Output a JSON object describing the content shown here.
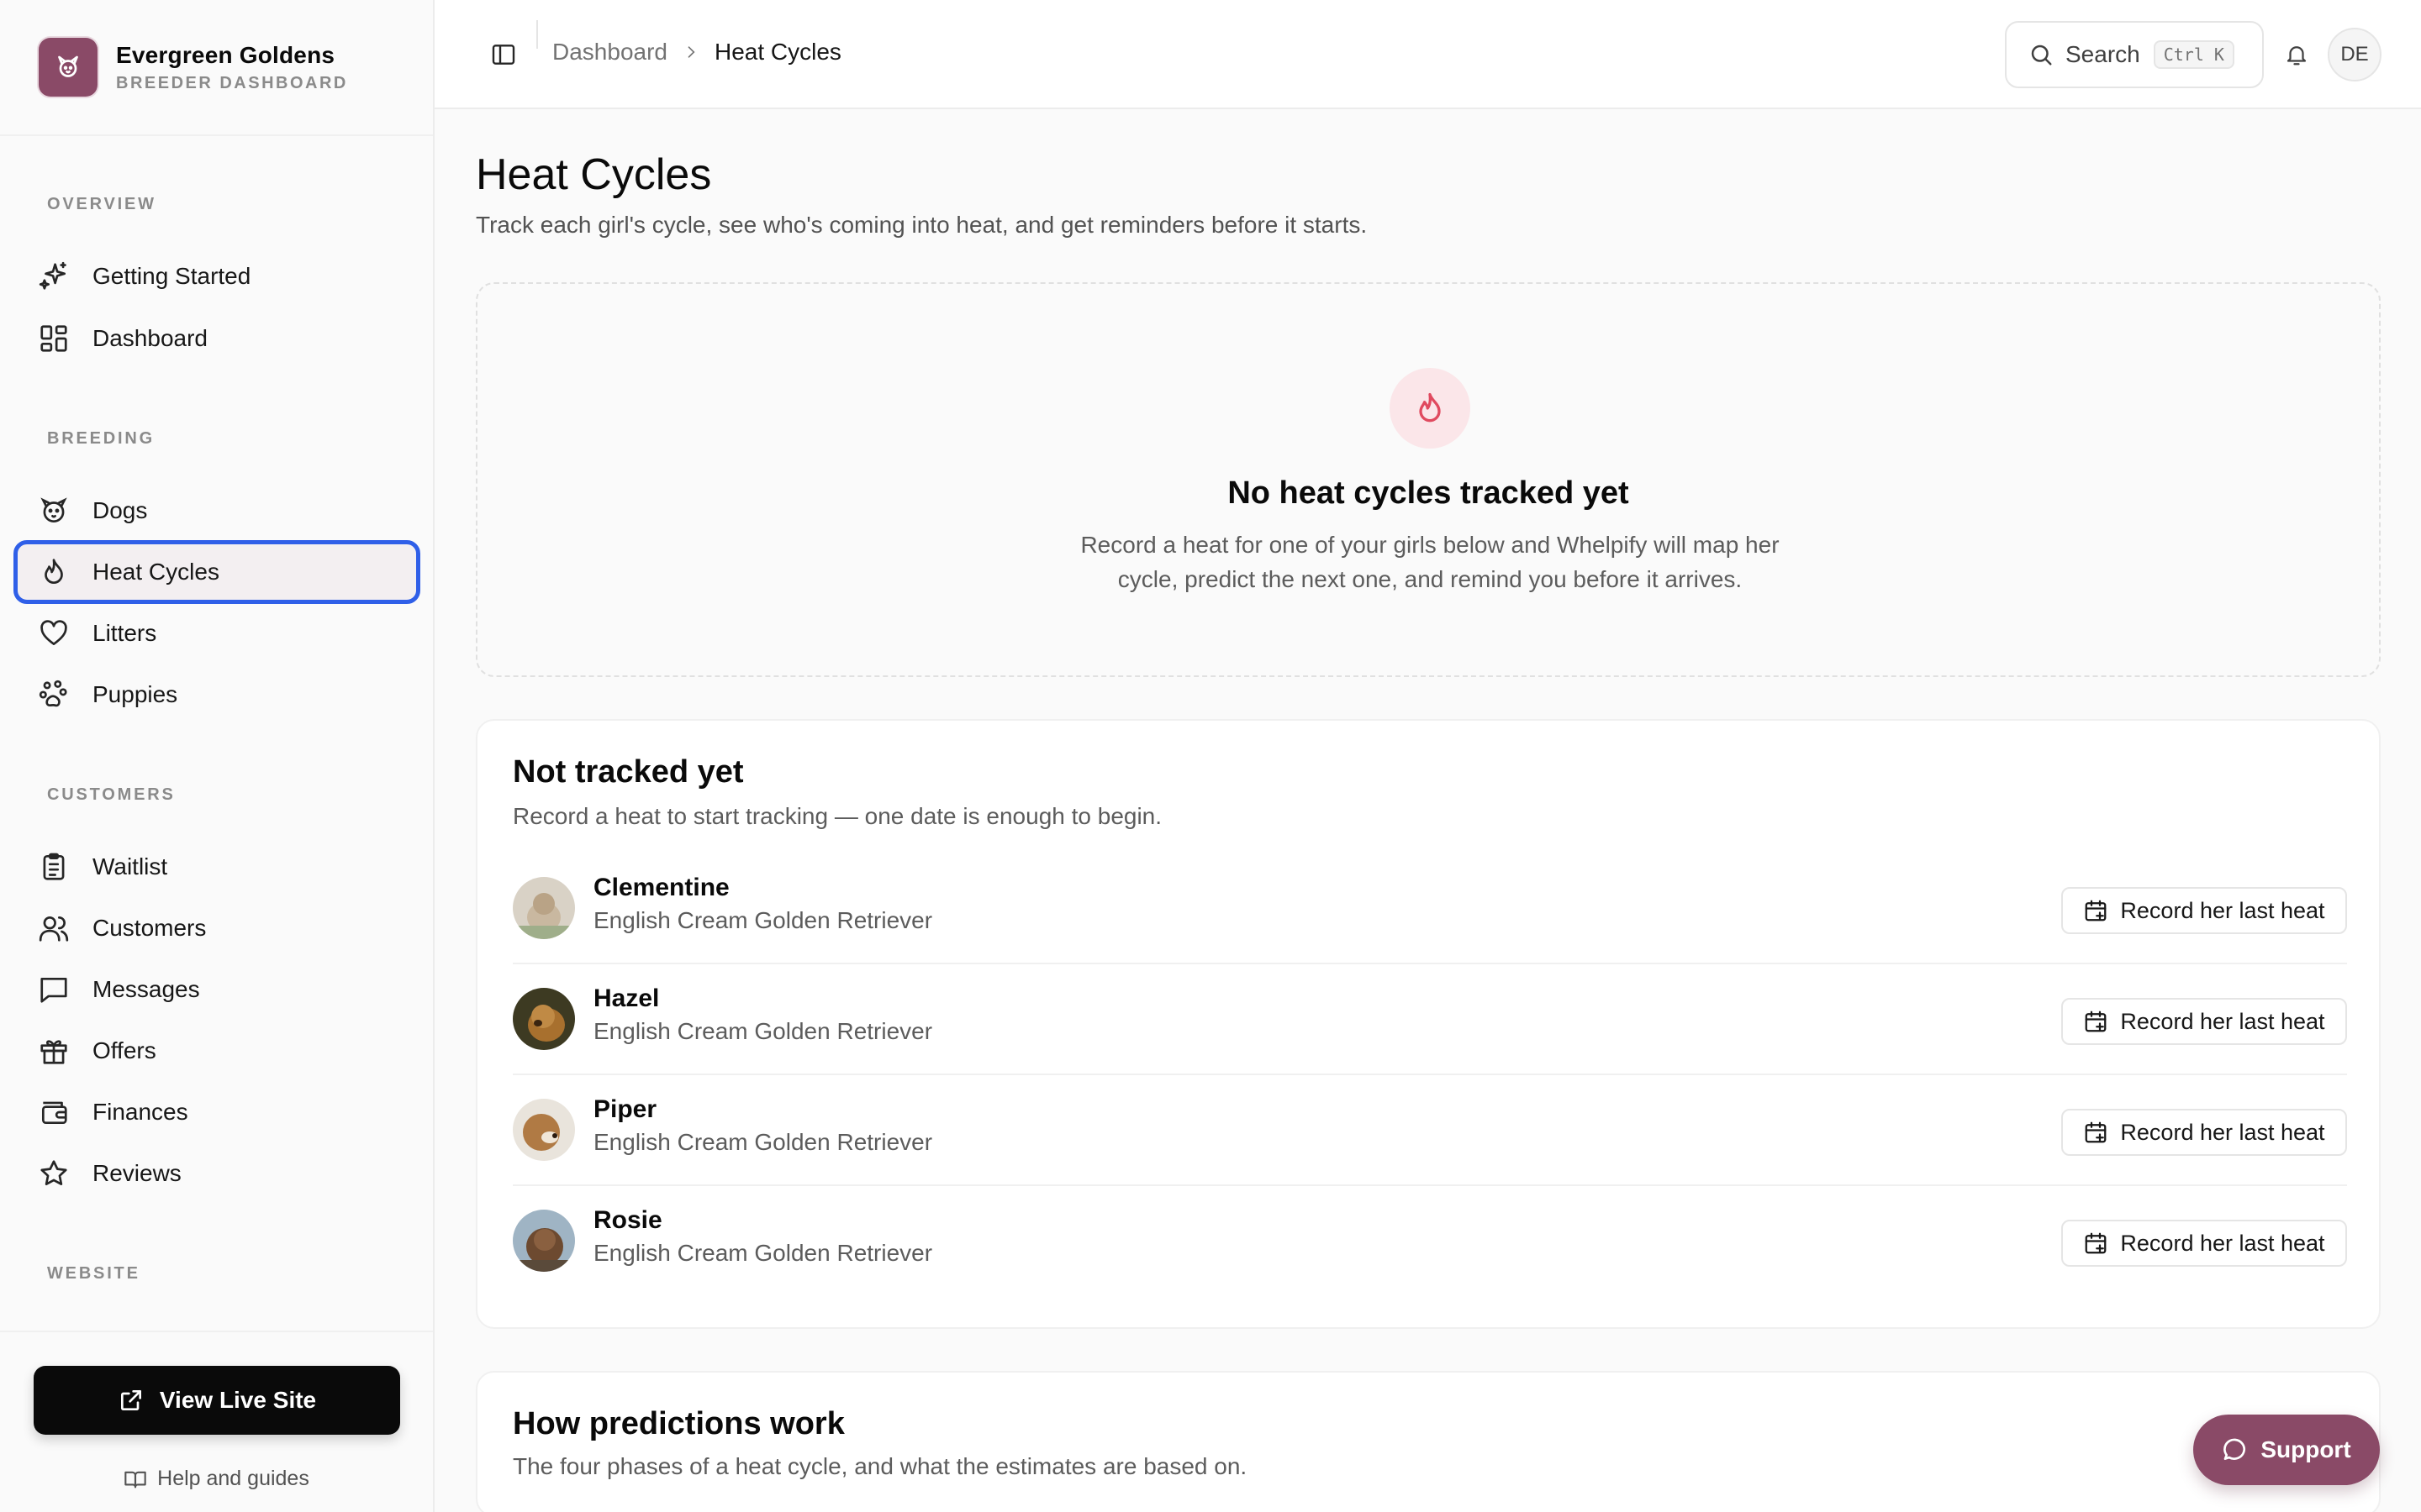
{
  "brand": {
    "name": "Evergreen Goldens",
    "subtitle": "BREEDER DASHBOARD"
  },
  "sidebar": {
    "sections": [
      {
        "label": "OVERVIEW",
        "items": [
          {
            "label": "Getting Started",
            "icon": "sparkles-icon"
          },
          {
            "label": "Dashboard",
            "icon": "grid-icon"
          }
        ]
      },
      {
        "label": "BREEDING",
        "items": [
          {
            "label": "Dogs",
            "icon": "dog-icon"
          },
          {
            "label": "Heat Cycles",
            "icon": "flame-icon",
            "active": true
          },
          {
            "label": "Litters",
            "icon": "heart-icon"
          },
          {
            "label": "Puppies",
            "icon": "paw-icon"
          }
        ]
      },
      {
        "label": "CUSTOMERS",
        "items": [
          {
            "label": "Waitlist",
            "icon": "clipboard-icon"
          },
          {
            "label": "Customers",
            "icon": "users-icon"
          },
          {
            "label": "Messages",
            "icon": "message-icon"
          },
          {
            "label": "Offers",
            "icon": "gift-icon"
          },
          {
            "label": "Finances",
            "icon": "wallet-icon"
          },
          {
            "label": "Reviews",
            "icon": "star-icon"
          }
        ]
      },
      {
        "label": "WEBSITE",
        "items": []
      }
    ],
    "footer": {
      "live_site_label": "View Live Site",
      "help_label": "Help and guides"
    }
  },
  "header": {
    "breadcrumb": {
      "root": "Dashboard",
      "current": "Heat Cycles"
    },
    "search": {
      "label": "Search",
      "shortcut": "Ctrl K"
    },
    "user_initials": "DE"
  },
  "page": {
    "title": "Heat Cycles",
    "subtitle": "Track each girl's cycle, see who's coming into heat, and get reminders before it starts."
  },
  "empty_state": {
    "title": "No heat cycles tracked yet",
    "description": "Record a heat for one of your girls below and Whelpify will map her cycle, predict the next one, and remind you before it arrives."
  },
  "not_tracked": {
    "title": "Not tracked yet",
    "subtitle": "Record a heat to start tracking — one date is enough to begin.",
    "button_label": "Record her last heat",
    "dogs": [
      {
        "name": "Clementine",
        "breed": "English Cream Golden Retriever",
        "photo_color": "#c9b8a0"
      },
      {
        "name": "Hazel",
        "breed": "English Cream Golden Retriever",
        "photo_color": "#a8702e"
      },
      {
        "name": "Piper",
        "breed": "English Cream Golden Retriever",
        "photo_color": "#b07a44"
      },
      {
        "name": "Rosie",
        "breed": "English Cream Golden Retriever",
        "photo_color": "#6d4a30"
      }
    ]
  },
  "predictions": {
    "title": "How predictions work",
    "subtitle": "The four phases of a heat cycle, and what the estimates are based on."
  },
  "support": {
    "label": "Support"
  },
  "colors": {
    "accent": "#8a4a67",
    "focus_ring": "#2f5fe8",
    "flame": "#e04a5f"
  }
}
